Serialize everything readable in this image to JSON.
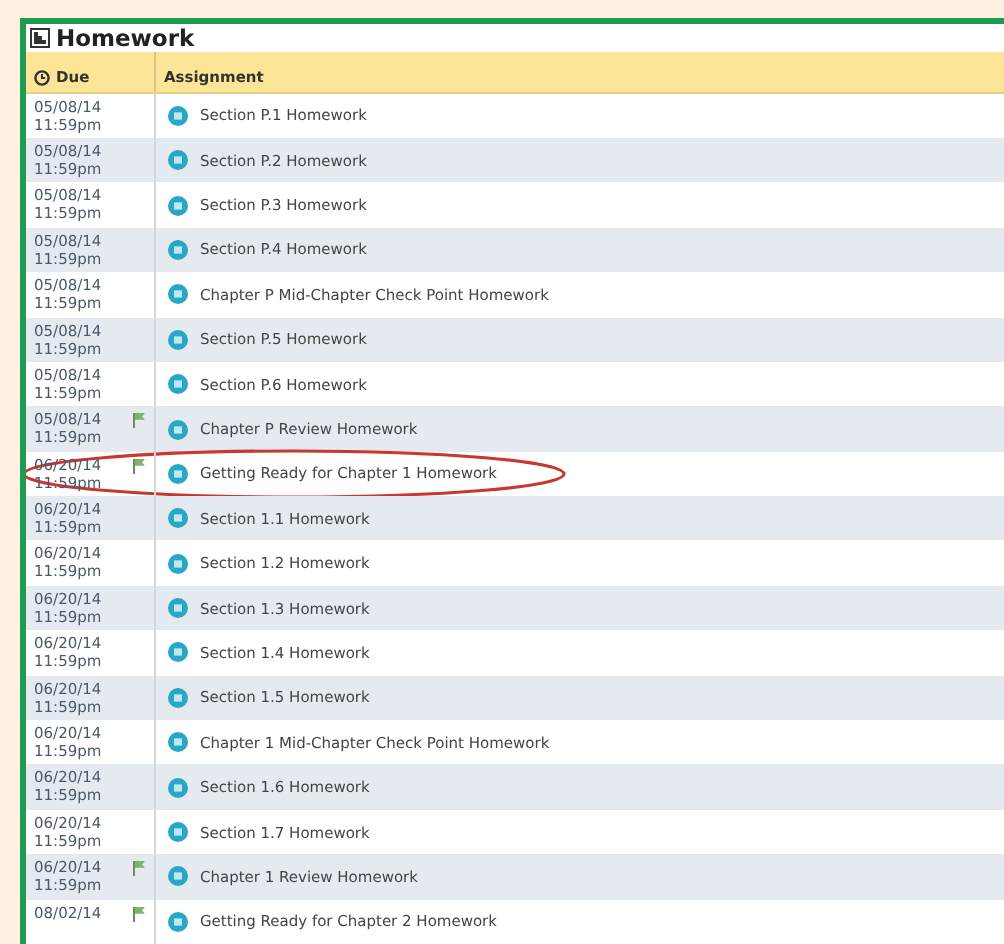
{
  "panel": {
    "title": "Homework"
  },
  "columns": {
    "due": "Due",
    "assignment": "Assignment"
  },
  "rows": [
    {
      "date": "05/08/14",
      "time": "11:59pm",
      "assignment": "Section P.1 Homework",
      "flagged": false,
      "circled": false
    },
    {
      "date": "05/08/14",
      "time": "11:59pm",
      "assignment": "Section P.2 Homework",
      "flagged": false,
      "circled": false
    },
    {
      "date": "05/08/14",
      "time": "11:59pm",
      "assignment": "Section P.3 Homework",
      "flagged": false,
      "circled": false
    },
    {
      "date": "05/08/14",
      "time": "11:59pm",
      "assignment": "Section P.4 Homework",
      "flagged": false,
      "circled": false
    },
    {
      "date": "05/08/14",
      "time": "11:59pm",
      "assignment": "Chapter P Mid-Chapter Check Point Homework",
      "flagged": false,
      "circled": false
    },
    {
      "date": "05/08/14",
      "time": "11:59pm",
      "assignment": "Section P.5 Homework",
      "flagged": false,
      "circled": false
    },
    {
      "date": "05/08/14",
      "time": "11:59pm",
      "assignment": "Section P.6 Homework",
      "flagged": false,
      "circled": false
    },
    {
      "date": "05/08/14",
      "time": "11:59pm",
      "assignment": "Chapter P Review Homework",
      "flagged": true,
      "circled": false
    },
    {
      "date": "06/20/14",
      "time": "11:59pm",
      "assignment": "Getting Ready for Chapter 1 Homework",
      "flagged": true,
      "circled": true
    },
    {
      "date": "06/20/14",
      "time": "11:59pm",
      "assignment": "Section 1.1 Homework",
      "flagged": false,
      "circled": false
    },
    {
      "date": "06/20/14",
      "time": "11:59pm",
      "assignment": "Section 1.2 Homework",
      "flagged": false,
      "circled": false
    },
    {
      "date": "06/20/14",
      "time": "11:59pm",
      "assignment": "Section 1.3 Homework",
      "flagged": false,
      "circled": false
    },
    {
      "date": "06/20/14",
      "time": "11:59pm",
      "assignment": "Section 1.4 Homework",
      "flagged": false,
      "circled": false
    },
    {
      "date": "06/20/14",
      "time": "11:59pm",
      "assignment": "Section 1.5 Homework",
      "flagged": false,
      "circled": false
    },
    {
      "date": "06/20/14",
      "time": "11:59pm",
      "assignment": "Chapter 1 Mid-Chapter Check Point Homework",
      "flagged": false,
      "circled": false
    },
    {
      "date": "06/20/14",
      "time": "11:59pm",
      "assignment": "Section 1.6 Homework",
      "flagged": false,
      "circled": false
    },
    {
      "date": "06/20/14",
      "time": "11:59pm",
      "assignment": "Section 1.7 Homework",
      "flagged": false,
      "circled": false
    },
    {
      "date": "06/20/14",
      "time": "11:59pm",
      "assignment": "Chapter 1 Review Homework",
      "flagged": true,
      "circled": false
    },
    {
      "date": "08/02/14",
      "assignment": "Getting Ready for Chapter 2 Homework",
      "flagged": true,
      "circled": false
    }
  ]
}
